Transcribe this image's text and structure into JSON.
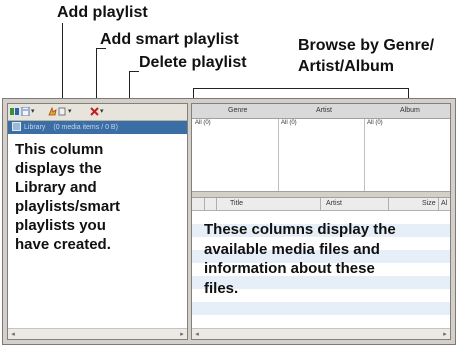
{
  "callouts": {
    "add_playlist": "Add playlist",
    "add_smart_playlist": "Add smart playlist",
    "delete_playlist": "Delete playlist",
    "browse_line1": "Browse by Genre/",
    "browse_line2": "Artist/Album"
  },
  "left_pane": {
    "toolbar_icons": [
      "add-playlist-icon",
      "add-smart-playlist-icon",
      "delete-playlist-icon"
    ],
    "library_label": "Library",
    "library_count": "(0 media items / 0 B)",
    "description_lines": [
      "This column",
      "displays the",
      "Library and",
      "playlists/smart",
      "playlists you",
      "have created."
    ]
  },
  "browser": {
    "columns": [
      "Genre",
      "Artist",
      "Album"
    ],
    "all_items": [
      "All (0)",
      "All (0)",
      "All (0)"
    ]
  },
  "track_table": {
    "columns": [
      "Title",
      "Artist",
      "Size",
      "Al"
    ],
    "description_lines": [
      "These columns display the",
      "available media files and",
      "information about these",
      "files."
    ]
  },
  "scroll_arrows": {
    "left": "◂",
    "right": "▸"
  },
  "colors": {
    "library_highlight": "#3a6ea5",
    "row_alt": "#e6eef8",
    "pane_bg": "#d4d0c8"
  }
}
